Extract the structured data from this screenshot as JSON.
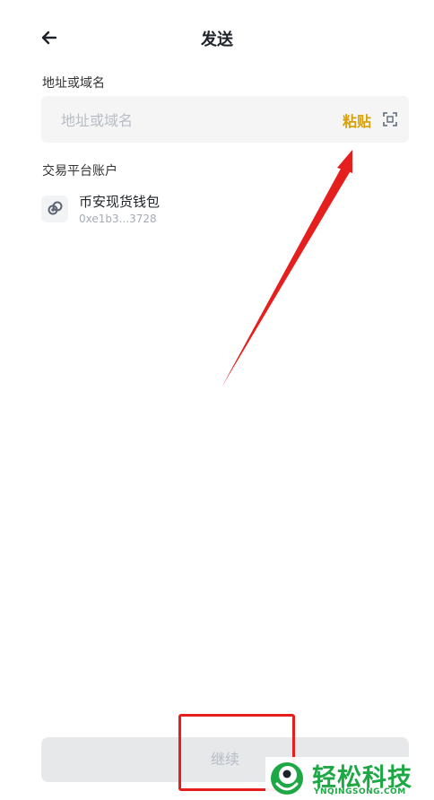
{
  "header": {
    "title": "发送",
    "back_icon": "arrow-left-icon"
  },
  "address_field": {
    "label": "地址或域名",
    "placeholder": "地址或域名",
    "value": "",
    "paste_label": "粘贴",
    "scan_icon": "scan-icon"
  },
  "exchange_section": {
    "label": "交易平台账户",
    "accounts": [
      {
        "name": "币安现货钱包",
        "address": "0xe1b3...3728",
        "icon": "binance-wallet-icon"
      }
    ]
  },
  "footer": {
    "continue_label": "继续",
    "enabled": false
  },
  "watermark": {
    "title": "轻松科技",
    "subtitle": "YNQINGSONG.COM"
  },
  "colors": {
    "accent": "#d8a10b",
    "text_primary": "#1e2329",
    "text_secondary": "#a5abb3",
    "input_bg": "#f5f5f5",
    "button_disabled_bg": "#e6e8ea",
    "annotation_red": "#e51e1e",
    "watermark_green": "#1ea845"
  }
}
